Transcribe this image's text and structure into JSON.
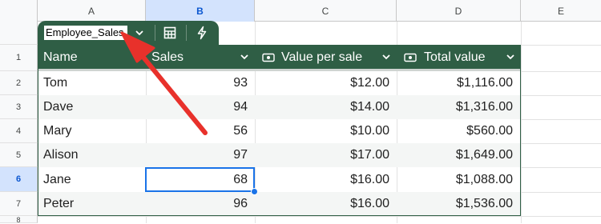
{
  "columns": [
    "A",
    "B",
    "C",
    "D",
    "E"
  ],
  "selected_column": "B",
  "rows": [
    "1",
    "2",
    "3",
    "4",
    "5",
    "6",
    "7",
    "8"
  ],
  "selected_row": "6",
  "table": {
    "name": "Employee_Sales",
    "headers": [
      {
        "label": "Name",
        "icon": "text-type-icon"
      },
      {
        "label": "Sales",
        "icon": "number-type-icon"
      },
      {
        "label": "Value per sale",
        "icon": "currency-icon"
      },
      {
        "label": "Total value",
        "icon": "currency-icon"
      }
    ],
    "records": [
      {
        "name": "Tom",
        "sales": "93",
        "value_per_sale": "$12.00",
        "total_value": "$1,116.00"
      },
      {
        "name": "Dave",
        "sales": "94",
        "value_per_sale": "$14.00",
        "total_value": "$1,316.00"
      },
      {
        "name": "Mary",
        "sales": "56",
        "value_per_sale": "$10.00",
        "total_value": "$560.00"
      },
      {
        "name": "Alison",
        "sales": "97",
        "value_per_sale": "$17.00",
        "total_value": "$1,649.00"
      },
      {
        "name": "Jane",
        "sales": "68",
        "value_per_sale": "$16.00",
        "total_value": "$1,088.00"
      },
      {
        "name": "Peter",
        "sales": "96",
        "value_per_sale": "$16.00",
        "total_value": "$1,536.00"
      }
    ]
  },
  "selected_cell": "B6",
  "colors": {
    "table_header": "#2f5e45",
    "selection": "#1a73e8",
    "header_highlight": "#d3e3fd",
    "arrow": "#e8312b",
    "row_stripe": "#f4f6f5"
  }
}
